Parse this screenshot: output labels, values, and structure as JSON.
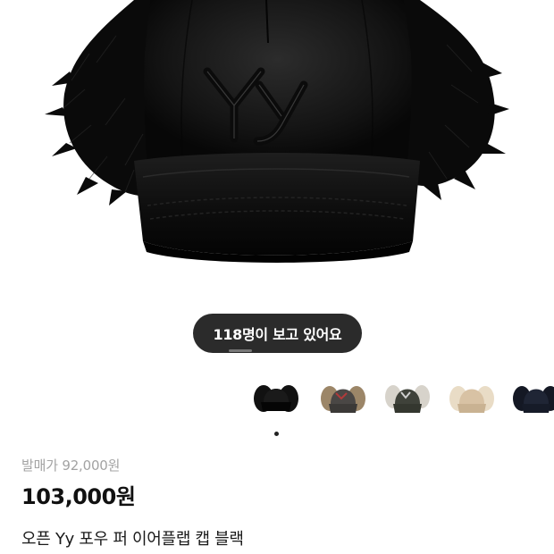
{
  "viewer_badge": "118명이 보고 있어요",
  "thumbnails": [
    {
      "icon": "black-cap-thumbnail",
      "color": "#0e0e0e",
      "fur": "#1a1a1a"
    },
    {
      "icon": "grey-tan-cap-thumbnail",
      "color": "#4a4745",
      "fur": "#9c8668"
    },
    {
      "icon": "olive-cap-thumbnail",
      "color": "#3f423a",
      "fur": "#d7d3cb"
    },
    {
      "icon": "beige-cap-thumbnail",
      "color": "#d8c2a4",
      "fur": "#e9dcc6"
    },
    {
      "icon": "navy-cap-thumbnail",
      "color": "#1f2535",
      "fur": "#141824"
    }
  ],
  "product": {
    "original_price": "발매가 92,000원",
    "price": "103,000원",
    "name": "오픈 Yy 포우 퍼 이어플랩 캡 블랙"
  }
}
